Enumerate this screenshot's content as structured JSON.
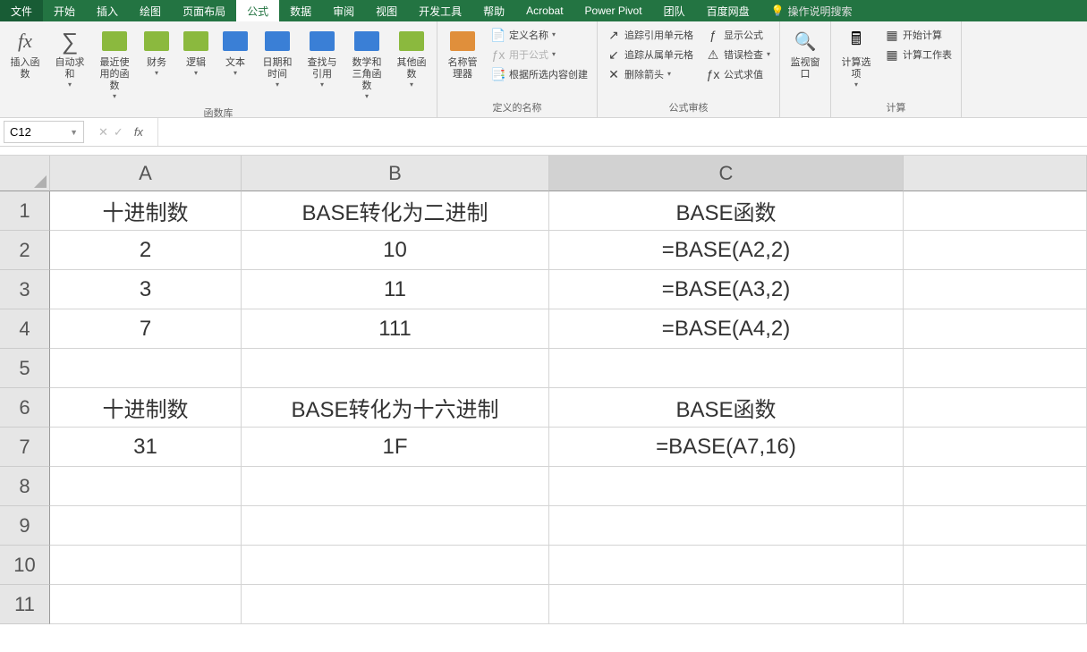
{
  "menu": {
    "items": [
      "文件",
      "开始",
      "插入",
      "绘图",
      "页面布局",
      "公式",
      "数据",
      "审阅",
      "视图",
      "开发工具",
      "帮助",
      "Acrobat",
      "Power Pivot",
      "团队",
      "百度网盘"
    ],
    "active_index": 5,
    "tell_me": "操作说明搜索"
  },
  "ribbon": {
    "insert_function": "插入函数",
    "autosum": "自动求和",
    "recently_used": "最近使用的函数",
    "financial": "财务",
    "logical": "逻辑",
    "text": "文本",
    "date_time": "日期和时间",
    "lookup_ref": "查找与引用",
    "math_trig": "数学和三角函数",
    "more_funcs": "其他函数",
    "group_func_lib": "函数库",
    "name_mgr": "名称管理器",
    "define_name": "定义名称",
    "use_in_formula": "用于公式",
    "create_from_sel": "根据所选内容创建",
    "group_defined_names": "定义的名称",
    "trace_prec": "追踪引用单元格",
    "trace_dep": "追踪从属单元格",
    "remove_arrows": "删除箭头",
    "show_formulas": "显示公式",
    "error_check": "错误检查",
    "eval_formula": "公式求值",
    "group_audit": "公式审核",
    "watch_window": "监视窗口",
    "calc_options": "计算选项",
    "calc_now": "开始计算",
    "calc_sheet": "计算工作表",
    "group_calc": "计算"
  },
  "formula_bar": {
    "name_box": "C12",
    "formula": ""
  },
  "sheet": {
    "columns": [
      "A",
      "B",
      "C",
      ""
    ],
    "selected_col_index": 2,
    "selected_cell": {
      "row": 12,
      "col": 2
    },
    "rows": [
      {
        "n": "1",
        "cells": [
          "十进制数",
          "BASE转化为二进制",
          "BASE函数",
          ""
        ]
      },
      {
        "n": "2",
        "cells": [
          "2",
          "10",
          "=BASE(A2,2)",
          ""
        ]
      },
      {
        "n": "3",
        "cells": [
          "3",
          "11",
          "=BASE(A3,2)",
          ""
        ]
      },
      {
        "n": "4",
        "cells": [
          "7",
          "111",
          "=BASE(A4,2)",
          ""
        ]
      },
      {
        "n": "5",
        "cells": [
          "",
          "",
          "",
          ""
        ]
      },
      {
        "n": "6",
        "cells": [
          "十进制数",
          "BASE转化为十六进制",
          "BASE函数",
          ""
        ]
      },
      {
        "n": "7",
        "cells": [
          "31",
          "1F",
          "=BASE(A7,16)",
          ""
        ]
      },
      {
        "n": "8",
        "cells": [
          "",
          "",
          "",
          ""
        ]
      },
      {
        "n": "9",
        "cells": [
          "",
          "",
          "",
          ""
        ]
      },
      {
        "n": "10",
        "cells": [
          "",
          "",
          "",
          ""
        ]
      },
      {
        "n": "11",
        "cells": [
          "",
          "",
          "",
          ""
        ]
      }
    ]
  }
}
